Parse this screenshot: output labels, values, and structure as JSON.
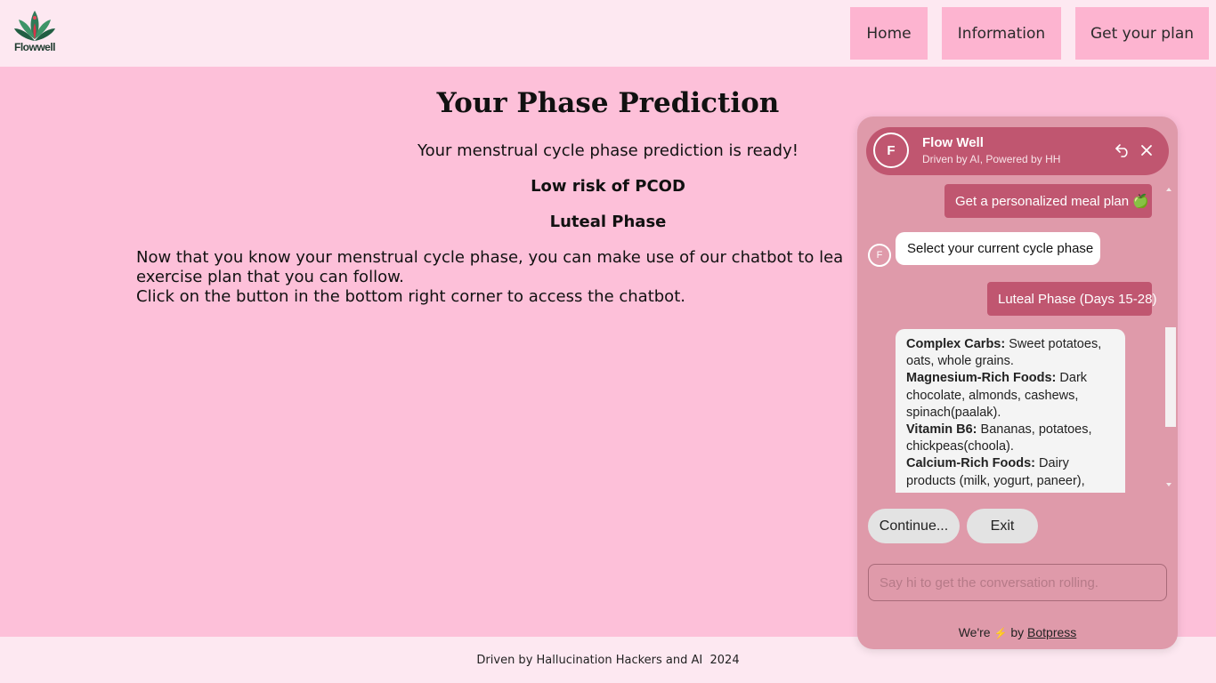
{
  "header": {
    "logo_text": "Flowwell",
    "nav": [
      {
        "label": "Home"
      },
      {
        "label": "Information"
      },
      {
        "label": "Get your plan"
      }
    ]
  },
  "main": {
    "title": "Your Phase Prediction",
    "subtitle": "Your menstrual cycle phase prediction is ready!",
    "risk": "Low risk of PCOD",
    "phase": "Luteal Phase",
    "body_line1": "Now that you know your menstrual cycle phase, you can make use of our chatbot to lea",
    "body_line2": "exercise plan that you can follow.",
    "body_line3": "Click on the button in the bottom right corner to access the chatbot."
  },
  "footer": {
    "text": "Driven by Hallucination Hackers and AI  2024"
  },
  "chat": {
    "avatar_letter": "F",
    "name": "Flow Well",
    "tagline": "Driven by AI, Powered by HH",
    "messages": {
      "user_1": "Get a personalized meal plan 🍏",
      "bot_1": "Select your current cycle phase",
      "user_2": "Luteal Phase (Days 15-28)",
      "list": [
        {
          "label": "Complex Carbs:",
          "text": " Sweet potatoes, oats, whole grains."
        },
        {
          "label": "Magnesium-Rich Foods:",
          "text": " Dark chocolate, almonds, cashews, spinach(paalak)."
        },
        {
          "label": "Vitamin B6:",
          "text": " Bananas, potatoes, chickpeas(choola)."
        },
        {
          "label": "Calcium-Rich Foods:",
          "text": " Dairy products (milk, yogurt, paneer),"
        }
      ]
    },
    "quick_replies": {
      "continue": "Continue...",
      "exit": "Exit"
    },
    "input_placeholder": "Say hi to get the conversation rolling.",
    "powered_prefix": "We're",
    "powered_mid": "by",
    "powered_link": "Botpress",
    "colors": {
      "header": "#c05670",
      "panel": "#df9aaa",
      "user_bubble": "#c05670"
    }
  }
}
